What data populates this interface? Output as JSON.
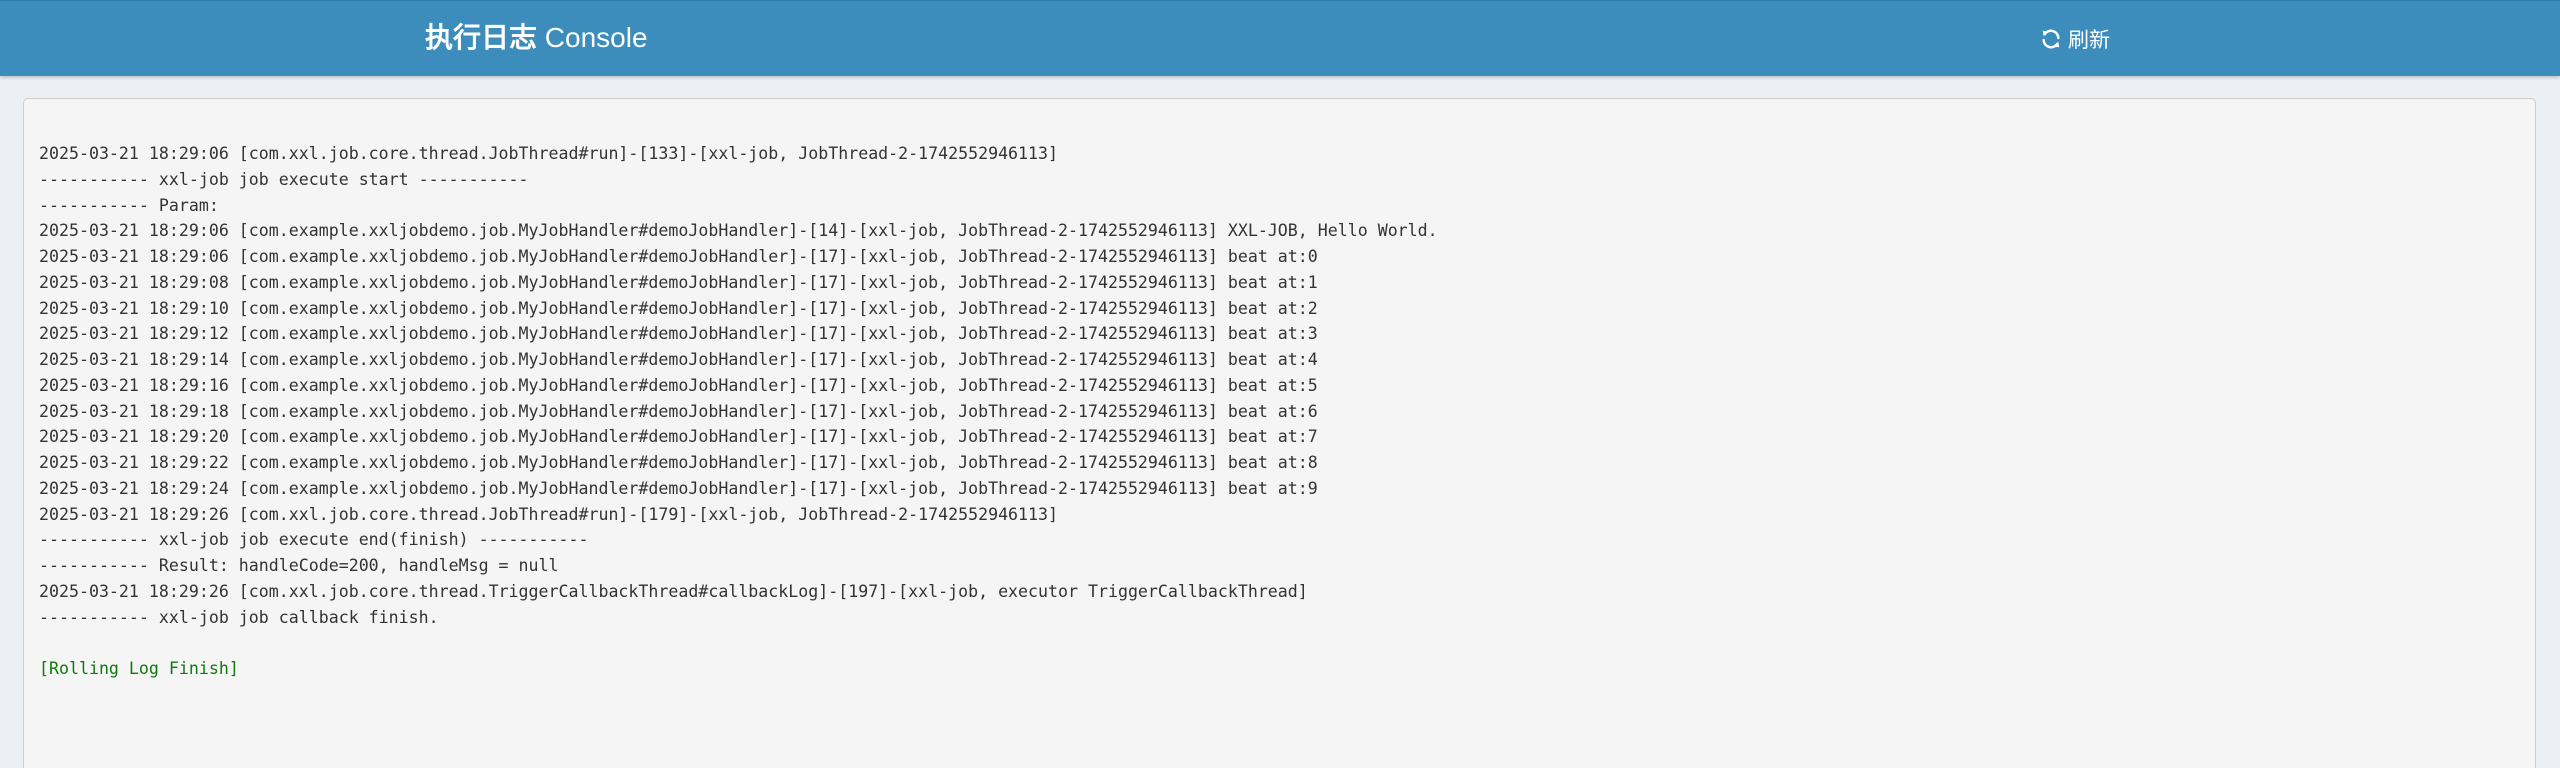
{
  "header": {
    "title_strong": "执行日志",
    "title_light": " Console",
    "refresh_label": "刷新",
    "refresh_icon": "refresh-icon",
    "background_color": "#3c8dbc"
  },
  "console": {
    "lines": [
      "2025-03-21 18:29:06 [com.xxl.job.core.thread.JobThread#run]-[133]-[xxl-job, JobThread-2-1742552946113]",
      "----------- xxl-job job execute start -----------",
      "----------- Param:",
      "2025-03-21 18:29:06 [com.example.xxljobdemo.job.MyJobHandler#demoJobHandler]-[14]-[xxl-job, JobThread-2-1742552946113] XXL-JOB, Hello World.",
      "2025-03-21 18:29:06 [com.example.xxljobdemo.job.MyJobHandler#demoJobHandler]-[17]-[xxl-job, JobThread-2-1742552946113] beat at:0",
      "2025-03-21 18:29:08 [com.example.xxljobdemo.job.MyJobHandler#demoJobHandler]-[17]-[xxl-job, JobThread-2-1742552946113] beat at:1",
      "2025-03-21 18:29:10 [com.example.xxljobdemo.job.MyJobHandler#demoJobHandler]-[17]-[xxl-job, JobThread-2-1742552946113] beat at:2",
      "2025-03-21 18:29:12 [com.example.xxljobdemo.job.MyJobHandler#demoJobHandler]-[17]-[xxl-job, JobThread-2-1742552946113] beat at:3",
      "2025-03-21 18:29:14 [com.example.xxljobdemo.job.MyJobHandler#demoJobHandler]-[17]-[xxl-job, JobThread-2-1742552946113] beat at:4",
      "2025-03-21 18:29:16 [com.example.xxljobdemo.job.MyJobHandler#demoJobHandler]-[17]-[xxl-job, JobThread-2-1742552946113] beat at:5",
      "2025-03-21 18:29:18 [com.example.xxljobdemo.job.MyJobHandler#demoJobHandler]-[17]-[xxl-job, JobThread-2-1742552946113] beat at:6",
      "2025-03-21 18:29:20 [com.example.xxljobdemo.job.MyJobHandler#demoJobHandler]-[17]-[xxl-job, JobThread-2-1742552946113] beat at:7",
      "2025-03-21 18:29:22 [com.example.xxljobdemo.job.MyJobHandler#demoJobHandler]-[17]-[xxl-job, JobThread-2-1742552946113] beat at:8",
      "2025-03-21 18:29:24 [com.example.xxljobdemo.job.MyJobHandler#demoJobHandler]-[17]-[xxl-job, JobThread-2-1742552946113] beat at:9",
      "2025-03-21 18:29:26 [com.xxl.job.core.thread.JobThread#run]-[179]-[xxl-job, JobThread-2-1742552946113]",
      "----------- xxl-job job execute end(finish) -----------",
      "----------- Result: handleCode=200, handleMsg = null",
      "2025-03-21 18:29:26 [com.xxl.job.core.thread.TriggerCallbackThread#callbackLog]-[197]-[xxl-job, executor TriggerCallbackThread]",
      "----------- xxl-job job callback finish.",
      "",
      "[Rolling Log Finish]"
    ],
    "finish_color": "#0e7a0e",
    "text_color": "#333333"
  }
}
